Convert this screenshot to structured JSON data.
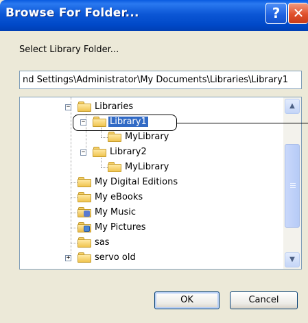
{
  "window": {
    "title": "Browse For Folder...",
    "help_glyph": "?",
    "close_glyph": "✕"
  },
  "prompt": "Select Library Folder...",
  "path_value": "nd Settings\\Administrator\\My Documents\\Libraries\\Library1",
  "tree": {
    "nodes": [
      {
        "label": "Libraries",
        "expander": "−"
      },
      {
        "label": "Library1",
        "expander": "−",
        "selected": true
      },
      {
        "label": "MyLibrary"
      },
      {
        "label": "Library2",
        "expander": "−"
      },
      {
        "label": "MyLibrary"
      },
      {
        "label": "My Digital Editions"
      },
      {
        "label": "My eBooks"
      },
      {
        "label": "My Music"
      },
      {
        "label": "My Pictures"
      },
      {
        "label": "sas"
      },
      {
        "label": "servo old",
        "expander": "+"
      }
    ]
  },
  "scroll": {
    "up_glyph": "▲",
    "down_glyph": "▼"
  },
  "buttons": {
    "ok": "OK",
    "cancel": "Cancel"
  },
  "colors": {
    "titlebar": "#0054e3",
    "selection": "#316ac5",
    "dialog_bg": "#ece9d8",
    "border": "#7f9db9"
  }
}
